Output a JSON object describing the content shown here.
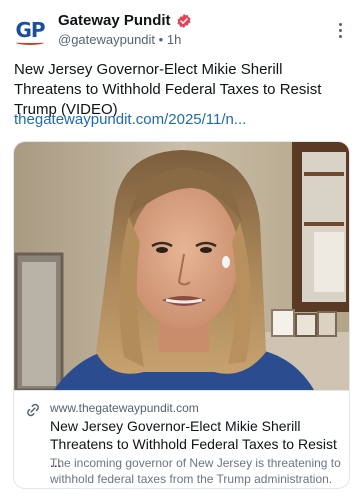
{
  "header": {
    "avatar_text": "GP",
    "display_name": "Gateway Pundit",
    "handle": "@gatewaypundit",
    "separator": "•",
    "time": "1h",
    "verified_icon": "verified-badge-icon",
    "more_icon": "more-vertical-icon"
  },
  "post": {
    "text": "New Jersey Governor-Elect Mikie Sherill Threatens to Withhold Federal Taxes to Resist Trump (VIDEO)",
    "link": "thegatewaypundit.com/2025/11/n..."
  },
  "card": {
    "image_description_icon": "video-thumbnail",
    "link_icon": "link-icon",
    "domain": "www.thegatewaypundit.com",
    "title": "New Jersey Governor-Elect Mikie Sherill Threatens to Withhold Federal Taxes to Resist ...",
    "description": "The incoming governor of New Jersey is threatening to withhold federal taxes from the Trump administration."
  },
  "colors": {
    "link_blue": "#1d6ab5",
    "verified_red": "#e2455b",
    "brand_blue": "#1b4f9c",
    "brand_red": "#d23b2a"
  }
}
